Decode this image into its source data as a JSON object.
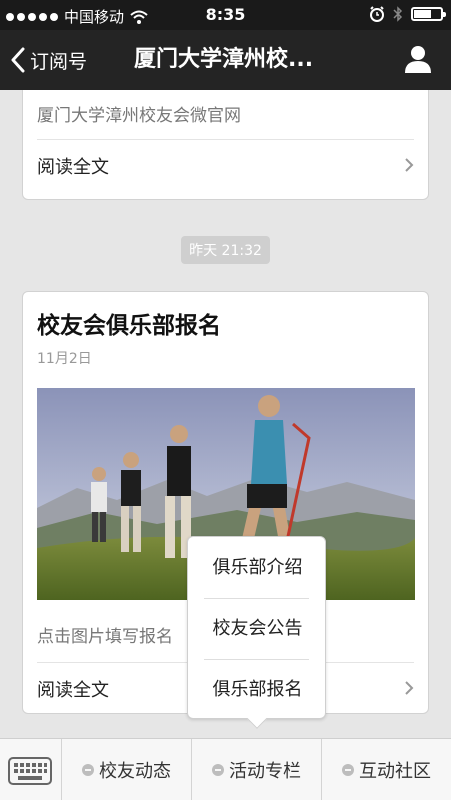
{
  "status_bar": {
    "carrier": "中国移动",
    "time": "8:35"
  },
  "nav": {
    "back_label": "订阅号",
    "title": "厦门大学漳州校..."
  },
  "articles": [
    {
      "summary": "厦门大学漳州校友会微官网",
      "read_more": "阅读全文"
    },
    {
      "title": "校友会俱乐部报名",
      "date": "11月2日",
      "summary": "点击图片填写报名",
      "read_more": "阅读全文"
    }
  ],
  "timestamp": "昨天 21:32",
  "popup_menu": {
    "items": [
      "俱乐部介绍",
      "校友会公告",
      "俱乐部报名"
    ]
  },
  "bottom_menu": {
    "tabs": [
      "校友动态",
      "活动专栏",
      "互动社区"
    ]
  },
  "colors": {
    "nav_bg": "#242424",
    "page_bg": "#e6e6e6",
    "card_bg": "#ffffff"
  }
}
